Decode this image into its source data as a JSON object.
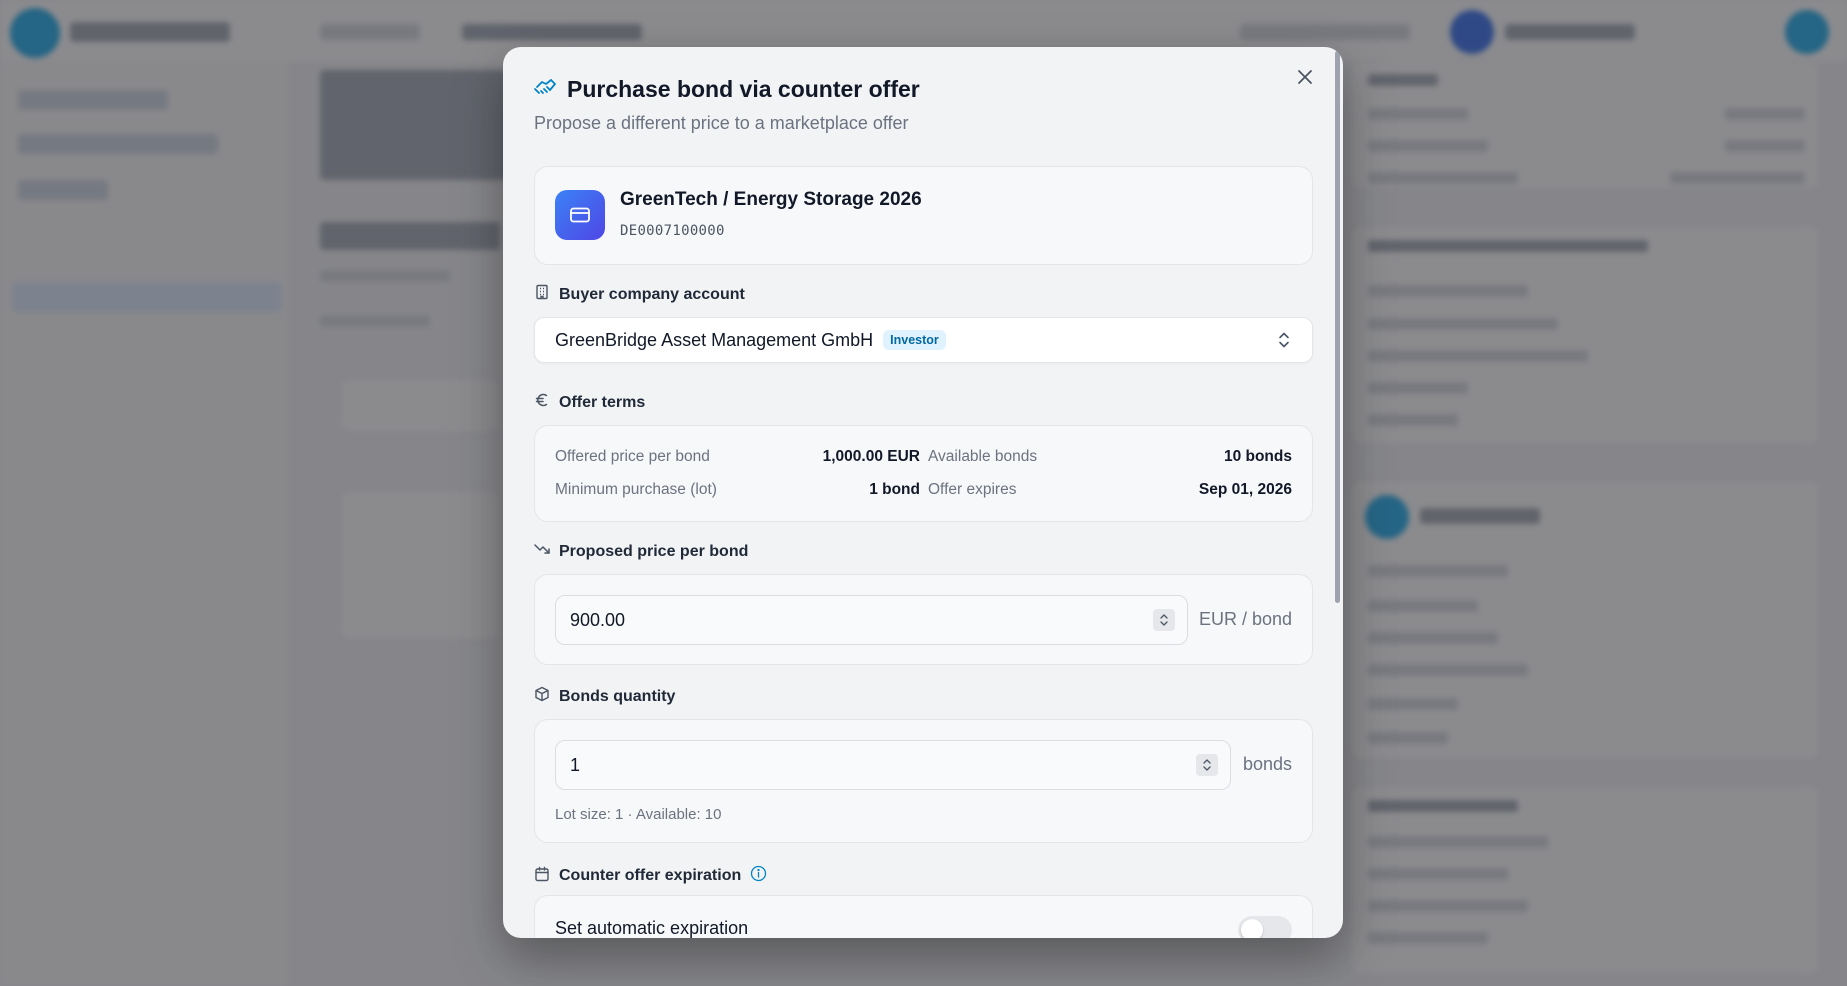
{
  "modal": {
    "title": "Purchase bond via counter offer",
    "subtitle": "Propose a different price to a marketplace offer"
  },
  "bond": {
    "name": "GreenTech / Energy Storage 2026",
    "isin": "DE0007100000"
  },
  "buyer": {
    "label": "Buyer company account",
    "value": "GreenBridge Asset Management GmbH",
    "badge": "Investor"
  },
  "terms": {
    "label": "Offer terms",
    "rows": [
      {
        "key": "Offered price per bond",
        "value": "1,000.00 EUR"
      },
      {
        "key": "Available bonds",
        "value": "10 bonds"
      },
      {
        "key": "Minimum purchase (lot)",
        "value": "1 bond"
      },
      {
        "key": "Offer expires",
        "value": "Sep 01, 2026"
      }
    ]
  },
  "price": {
    "label": "Proposed price per bond",
    "value": "900.00",
    "unit": "EUR / bond"
  },
  "quantity": {
    "label": "Bonds quantity",
    "value": "1",
    "unit": "bonds",
    "hint": "Lot size: 1 · Available: 10"
  },
  "expiration": {
    "label": "Counter offer expiration",
    "toggle_label": "Set automatic expiration",
    "toggle_on": false
  },
  "colors": {
    "accent": "#0284c7",
    "bond_icon_gradient": [
      "#3b82f6",
      "#4f46e5"
    ],
    "badge_bg": "#e0f2fe",
    "badge_text": "#0369a1"
  },
  "icons": {
    "title": "handshake-icon",
    "close": "close-icon",
    "bond": "credit-card-icon",
    "buyer": "building-icon",
    "terms": "euro-icon",
    "price": "trending-down-icon",
    "quantity": "package-icon",
    "expiration": "calendar-icon",
    "info": "info-icon"
  }
}
